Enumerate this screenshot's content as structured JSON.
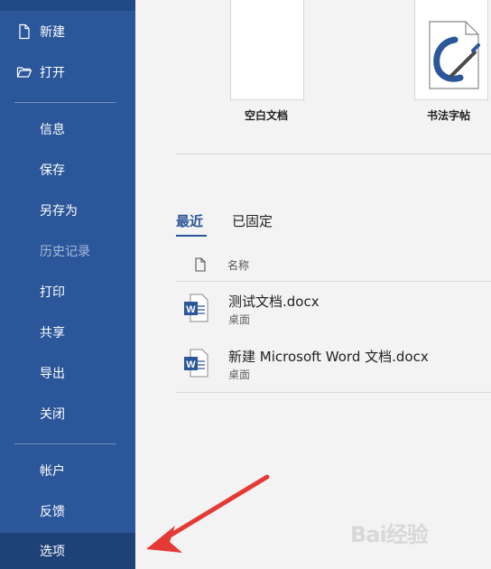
{
  "sidebar": {
    "items": [
      {
        "label": "新建",
        "icon": "new-file-icon"
      },
      {
        "label": "打开",
        "icon": "open-folder-icon"
      },
      {
        "label": "信息"
      },
      {
        "label": "保存"
      },
      {
        "label": "另存为"
      },
      {
        "label": "历史记录",
        "disabled": true
      },
      {
        "label": "打印"
      },
      {
        "label": "共享"
      },
      {
        "label": "导出"
      },
      {
        "label": "关闭"
      },
      {
        "label": "帐户"
      },
      {
        "label": "反馈"
      },
      {
        "label": "选项",
        "selected": true
      }
    ]
  },
  "templates": [
    {
      "label": "空白文档"
    },
    {
      "label": "书法字帖"
    }
  ],
  "tabs": {
    "recent": "最近",
    "pinned": "已固定"
  },
  "file_list": {
    "column_name": "名称",
    "files": [
      {
        "name": "测试文档.docx",
        "location": "桌面",
        "icon": "word-doc-icon"
      },
      {
        "name": "新建 Microsoft Word 文档.docx",
        "location": "桌面",
        "icon": "word-doc-icon"
      }
    ]
  },
  "watermark": "Bai经验",
  "colors": {
    "sidebar": "#2b579a",
    "sidebar_selected": "#1e4178",
    "arrow": "#e53935",
    "word_blue": "#2b579a"
  }
}
